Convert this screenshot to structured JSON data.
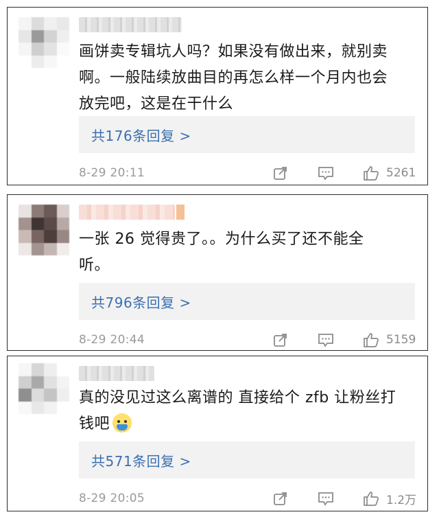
{
  "comments": [
    {
      "text": "画饼卖专辑坑人吗？如果没有做出来，就别卖\n啊。一般陆续放曲目的再怎么样一个月内也会\n放完吧，这是在干什么",
      "replies": "共176条回复 >",
      "time": "8-29 20:11",
      "likes": "5261"
    },
    {
      "text": "一张 26 觉得贵了。。为什么买了还不能全\n听。",
      "replies": "共796条回复 >",
      "time": "8-29 20:44",
      "likes": "5159"
    },
    {
      "text": "真的没见过这么离谱的 直接给个 zfb 让粉丝打\n钱吧",
      "emoji": "crying-face-emoji",
      "replies": "共571条回复 >",
      "time": "8-29 20:05",
      "likes": "1.2万"
    }
  ],
  "colors": {
    "reply_link": "#3b6fb0",
    "meta_gray": "#9a9a9a",
    "reply_bg": "#f2f2f2",
    "border": "#2b2b2b"
  },
  "icons": [
    "share-icon",
    "comment-icon",
    "thumbs-up-icon"
  ]
}
